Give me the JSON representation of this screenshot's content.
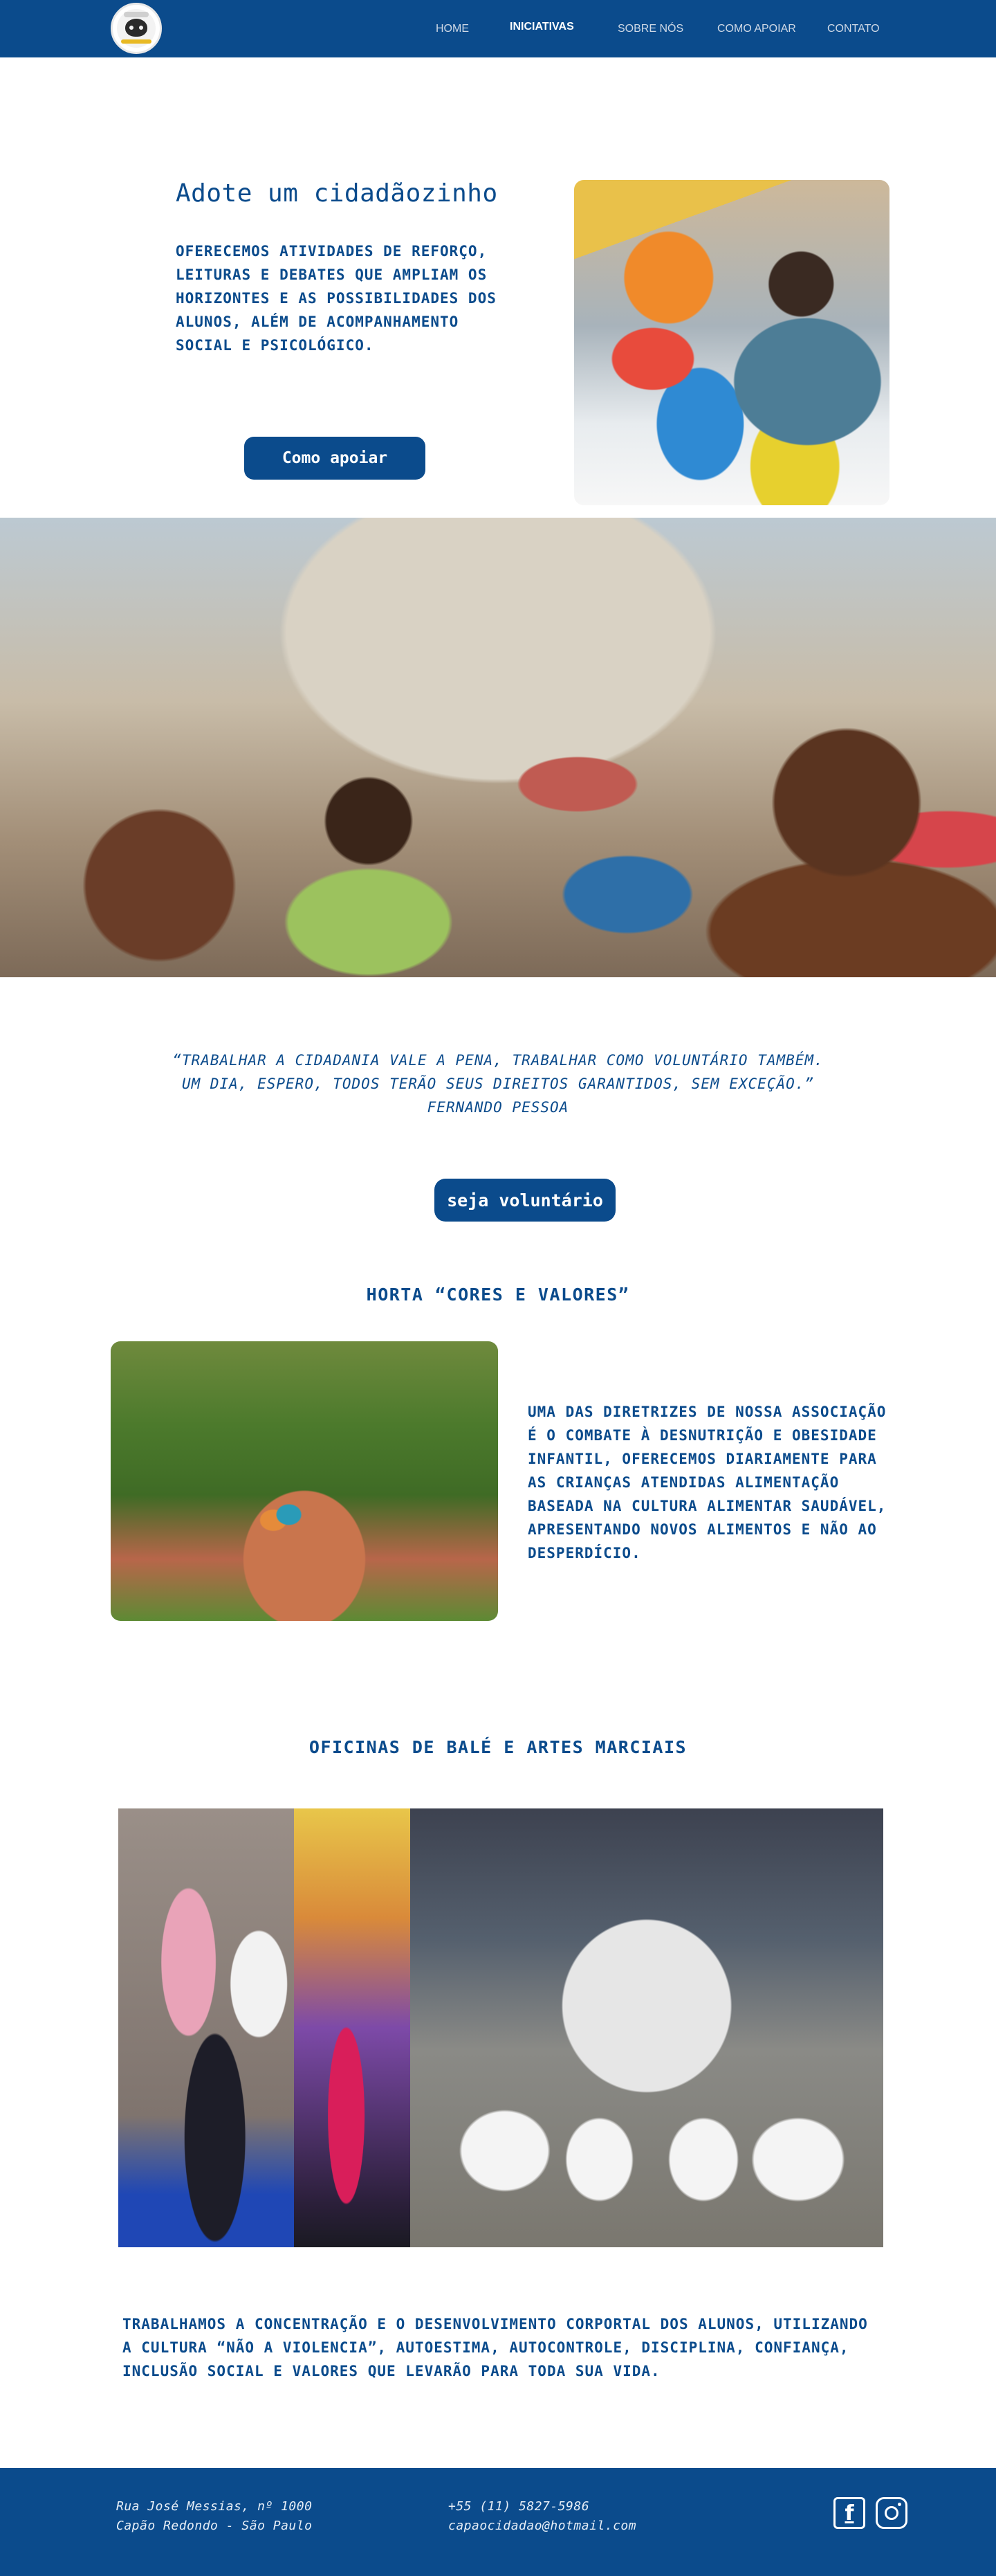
{
  "nav": {
    "items": [
      {
        "label": "HOME",
        "active": false
      },
      {
        "label": "INICIATIVAS",
        "active": true
      },
      {
        "label": "SOBRE NÓS",
        "active": false
      },
      {
        "label": "COMO APOIAR",
        "active": false
      },
      {
        "label": "CONTATO",
        "active": false
      }
    ]
  },
  "hero": {
    "title": "Adote um cidadãozinho",
    "description": "OFERECEMOS ATIVIDADES DE REFORÇO, LEITURAS E DEBATES QUE AMPLIAM OS HORIZONTES E AS POSSIBILIDADES DOS ALUNOS, ALÉM DE ACOMPANHAMENTO SOCIAL E PSICOLÓGICO.",
    "button_label": "Como apoiar"
  },
  "quote": {
    "line1": "“TRABALHAR A CIDADANIA VALE A PENA, TRABALHAR COMO VOLUNTÁRIO TAMBÉM.",
    "line2": "UM DIA, ESPERO, TODOS TERÃO SEUS DIREITOS GARANTIDOS, SEM EXCEÇÃO.”",
    "author": "FERNANDO PESSOA",
    "button_label": "seja voluntário"
  },
  "horta": {
    "title": "HORTA “CORES E VALORES”",
    "text": "UMA DAS DIRETRIZES DE NOSSA ASSOCIAÇÃO É O COMBATE À DESNUTRIÇÃO E OBESIDADE INFANTIL, OFERECEMOS DIARIAMENTE PARA AS CRIANÇAS ATENDIDAS ALIMENTAÇÃO BASEADA NA CULTURA ALIMENTAR SAUDÁVEL, APRESENTANDO NOVOS ALIMENTOS E NÃO AO DESPERDÍCIO."
  },
  "oficinas": {
    "title": "OFICINAS DE BALÉ E ARTES MARCIAIS",
    "text": "TRABALHAMOS A CONCENTRAÇÃO E O DESENVOLVIMENTO CORPORTAL DOS ALUNOS, UTILIZANDO A CULTURA “NÃO A VIOLENCIA”, AUTOESTIMA, AUTOCONTROLE, DISCIPLINA, CONFIANÇA, INCLUSÃO SOCIAL E VALORES QUE LEVARÃO PARA TODA SUA VIDA."
  },
  "footer": {
    "address_line1": "Rua José Messias, nº 1000",
    "address_line2": "Capão Redondo - São Paulo",
    "phone": "+55 (11) 5827-5986",
    "email": "capaocidadao@hotmail.com",
    "facebook_glyph": "f"
  },
  "colors": {
    "brand": "#0b4b8c",
    "nav_text": "#cfd9e6",
    "background": "#ffffff"
  },
  "icons": [
    "logo",
    "facebook-icon",
    "instagram-icon"
  ]
}
